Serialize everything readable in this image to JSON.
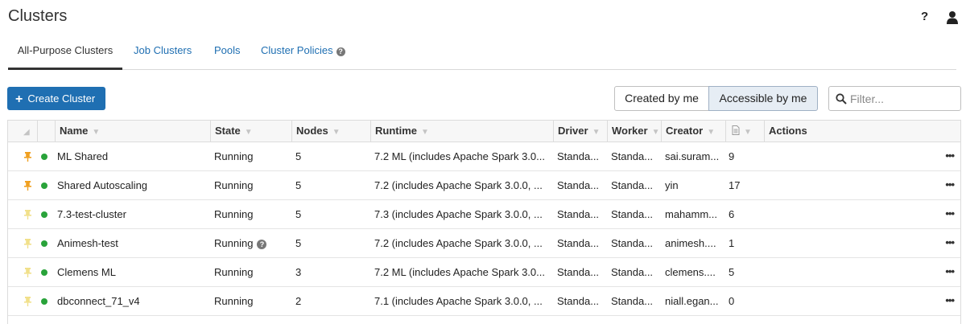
{
  "header": {
    "title": "Clusters",
    "help_icon": "?",
    "user_icon": "user-icon"
  },
  "tabs": [
    {
      "label": "All-Purpose Clusters",
      "active": true
    },
    {
      "label": "Job Clusters",
      "active": false
    },
    {
      "label": "Pools",
      "active": false
    },
    {
      "label": "Cluster Policies",
      "active": false
    }
  ],
  "toolbar": {
    "create_label": "Create Cluster",
    "filter_created": "Created by me",
    "filter_accessible": "Accessible by me",
    "filter_placeholder": "Filter..."
  },
  "table": {
    "columns": [
      "Name",
      "State",
      "Nodes",
      "Runtime",
      "Driver",
      "Worker",
      "Creator",
      "",
      "Actions"
    ],
    "rows": [
      {
        "pinned": true,
        "name": "ML Shared",
        "state": "Running",
        "state_info": false,
        "nodes": "5",
        "runtime": "7.2 ML (includes Apache Spark 3.0...",
        "driver": "Standa...",
        "worker": "Standa...",
        "creator": "sai.suram...",
        "notebooks": "9"
      },
      {
        "pinned": true,
        "name": "Shared Autoscaling",
        "state": "Running",
        "state_info": false,
        "nodes": "5",
        "runtime": "7.2 (includes Apache Spark 3.0.0, ...",
        "driver": "Standa...",
        "worker": "Standa...",
        "creator": "yin",
        "notebooks": "17"
      },
      {
        "pinned": false,
        "name": "7.3-test-cluster",
        "state": "Running",
        "state_info": false,
        "nodes": "5",
        "runtime": "7.3 (includes Apache Spark 3.0.0, ...",
        "driver": "Standa...",
        "worker": "Standa...",
        "creator": "mahamm...",
        "notebooks": "6"
      },
      {
        "pinned": false,
        "name": "Animesh-test",
        "state": "Running",
        "state_info": true,
        "nodes": "5",
        "runtime": "7.2 (includes Apache Spark 3.0.0, ...",
        "driver": "Standa...",
        "worker": "Standa...",
        "creator": "animesh....",
        "notebooks": "1"
      },
      {
        "pinned": false,
        "name": "Clemens ML",
        "state": "Running",
        "state_info": false,
        "nodes": "3",
        "runtime": "7.2 ML (includes Apache Spark 3.0...",
        "driver": "Standa...",
        "worker": "Standa...",
        "creator": "clemens....",
        "notebooks": "5"
      },
      {
        "pinned": false,
        "name": "dbconnect_71_v4",
        "state": "Running",
        "state_info": false,
        "nodes": "2",
        "runtime": "7.1 (includes Apache Spark 3.0.0, ...",
        "driver": "Standa...",
        "worker": "Standa...",
        "creator": "niall.egan...",
        "notebooks": "0"
      }
    ],
    "more_label": "•••"
  },
  "colors": {
    "link": "#1f6fb2",
    "primary_button": "#1f6fb2",
    "running_dot": "#29a33a",
    "pin_active": "#f0a020",
    "pin_inactive": "#f1e08a"
  }
}
